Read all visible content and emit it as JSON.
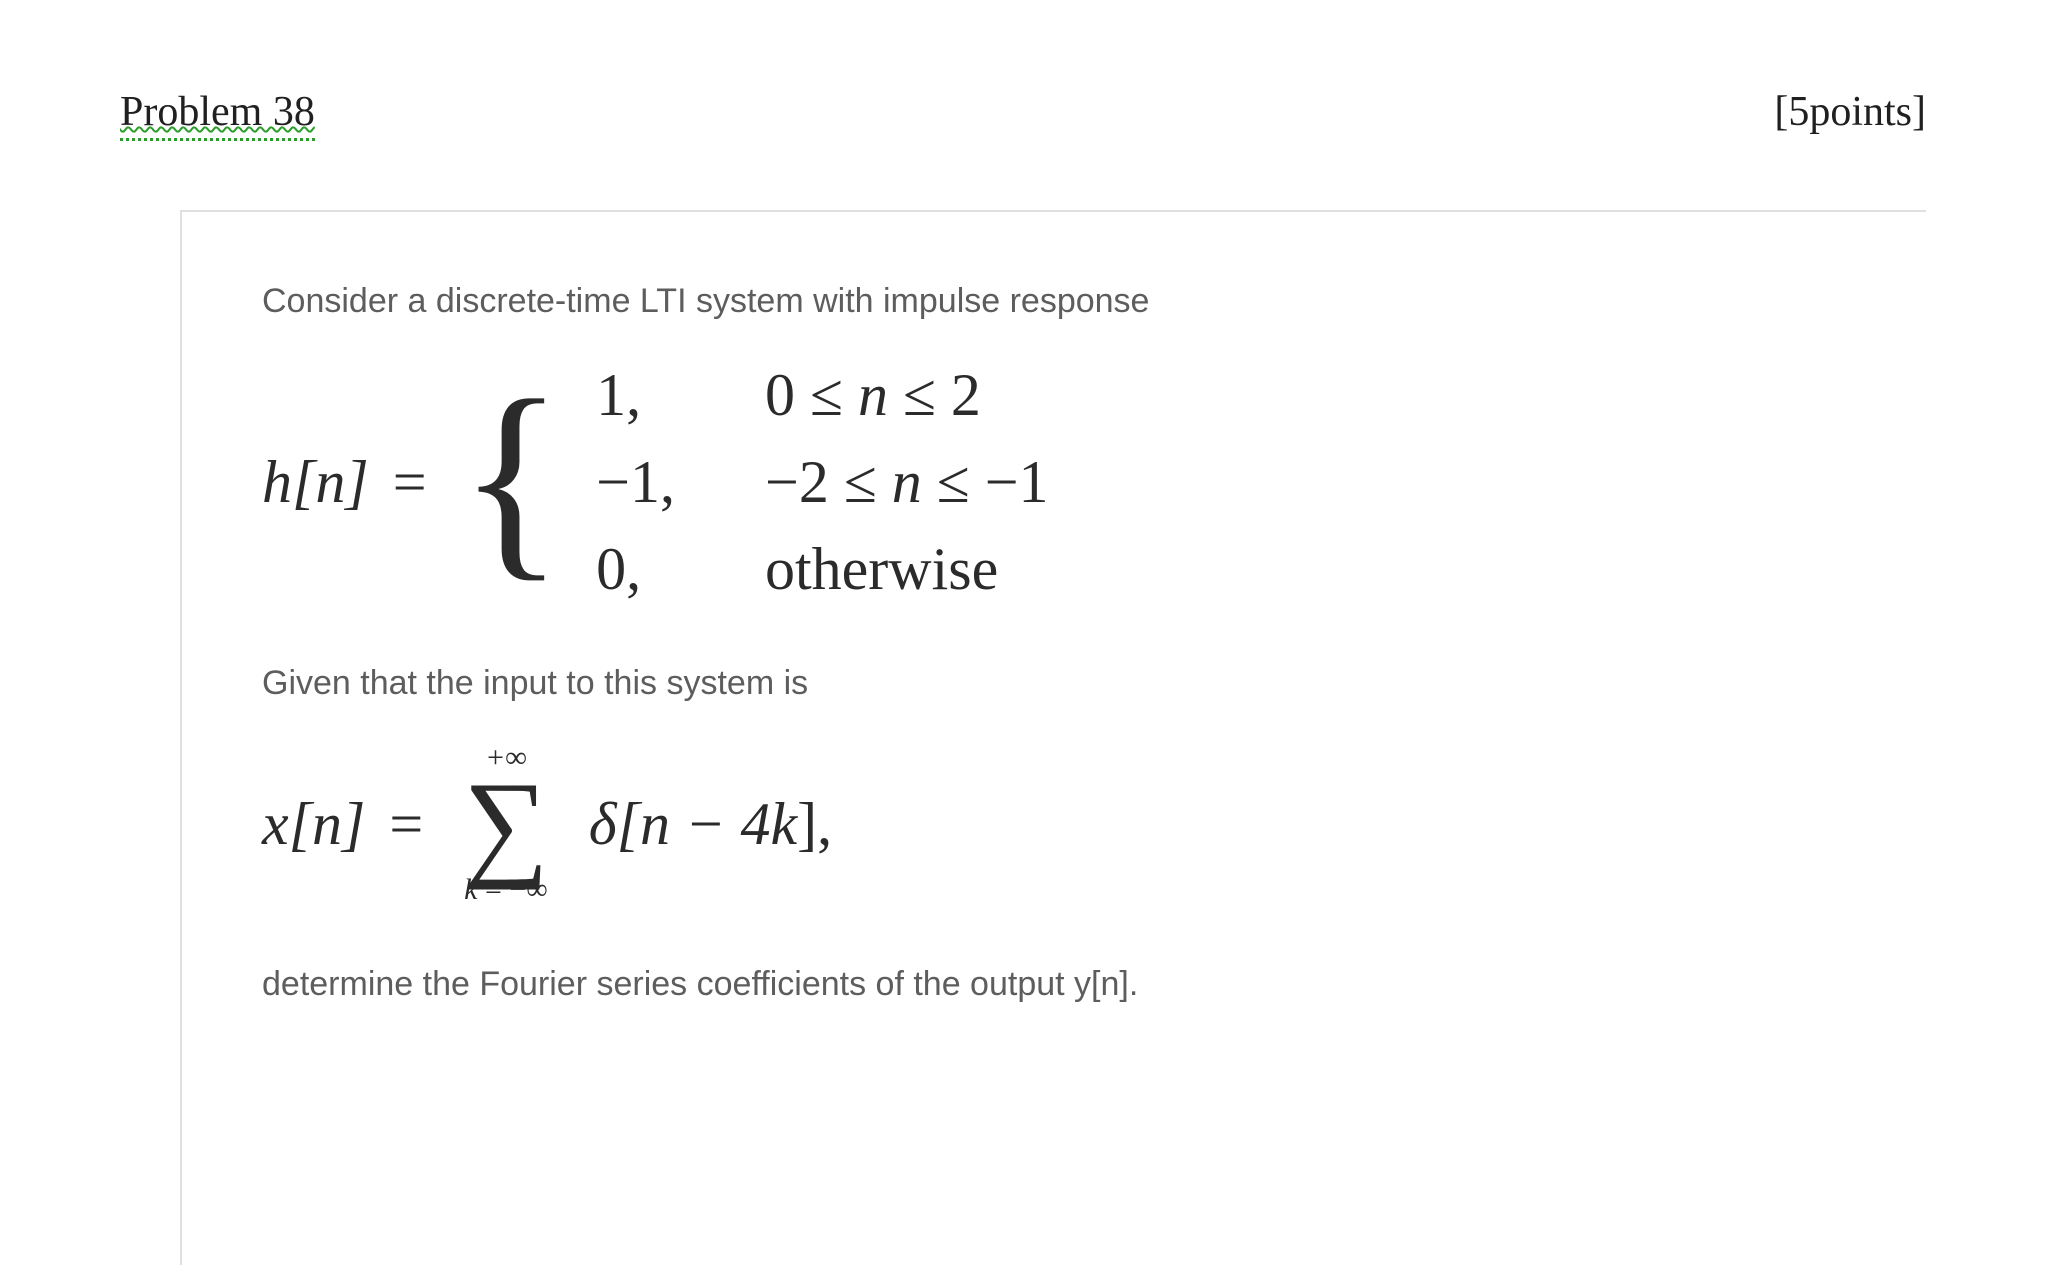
{
  "header": {
    "problem_label": "Problem 38",
    "points_label": "[5points]"
  },
  "body": {
    "intro": "Consider a discrete-time LTI system with impulse response",
    "h_lhs": "h[n]",
    "equals": "=",
    "piecewise": {
      "row1_val": "1,",
      "row1_cond_pre": "0 ≤ ",
      "row1_cond_var": "n",
      "row1_cond_post": " ≤ 2",
      "row2_val": "−1,",
      "row2_cond_pre": "−2 ≤ ",
      "row2_cond_var": "n",
      "row2_cond_post": " ≤ −1",
      "row3_val": "0,",
      "row3_cond": "otherwise"
    },
    "given": "Given that the input to this system is",
    "x_lhs": "x[n]",
    "sum_upper": "+∞",
    "sum_lower_var": "k",
    "sum_lower_rest": " = −∞",
    "delta_expr_pre": "δ[",
    "delta_expr_mid": "n − 4k",
    "delta_expr_post": "],",
    "conclusion": "determine the Fourier series coefficients of the output y[n]."
  }
}
